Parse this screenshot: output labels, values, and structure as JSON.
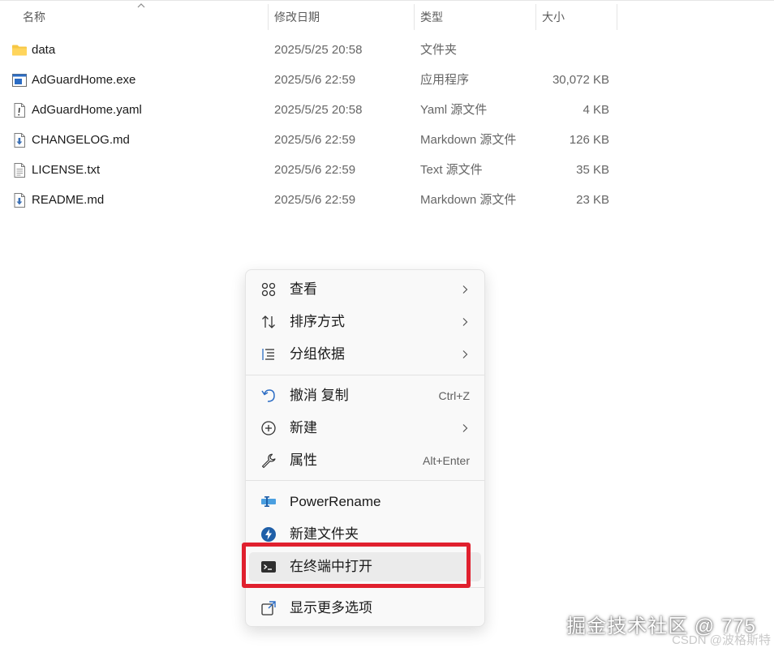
{
  "columns": {
    "name": "名称",
    "modified": "修改日期",
    "type": "类型",
    "size": "大小"
  },
  "files": [
    {
      "icon": "folder-icon",
      "name": "data",
      "modified": "2025/5/25 20:58",
      "type": "文件夹",
      "size": ""
    },
    {
      "icon": "exe-file-icon",
      "name": "AdGuardHome.exe",
      "modified": "2025/5/6 22:59",
      "type": "应用程序",
      "size": "30,072 KB"
    },
    {
      "icon": "yaml-file-icon",
      "name": "AdGuardHome.yaml",
      "modified": "2025/5/25 20:58",
      "type": "Yaml 源文件",
      "size": "4 KB"
    },
    {
      "icon": "markdown-file-icon",
      "name": "CHANGELOG.md",
      "modified": "2025/5/6 22:59",
      "type": "Markdown 源文件",
      "size": "126 KB"
    },
    {
      "icon": "text-file-icon",
      "name": "LICENSE.txt",
      "modified": "2025/5/6 22:59",
      "type": "Text 源文件",
      "size": "35 KB"
    },
    {
      "icon": "markdown-file-icon",
      "name": "README.md",
      "modified": "2025/5/6 22:59",
      "type": "Markdown 源文件",
      "size": "23 KB"
    }
  ],
  "context_menu": {
    "items": [
      {
        "icon": "grid-view-icon",
        "label": "查看",
        "submenu": true
      },
      {
        "icon": "sort-icon",
        "label": "排序方式",
        "submenu": true
      },
      {
        "icon": "group-by-icon",
        "label": "分组依据",
        "submenu": true
      },
      {
        "icon": "undo-icon",
        "label": "撤消 复制",
        "shortcut": "Ctrl+Z"
      },
      {
        "icon": "new-plus-icon",
        "label": "新建",
        "submenu": true
      },
      {
        "icon": "wrench-properties-icon",
        "label": "属性",
        "shortcut": "Alt+Enter"
      },
      {
        "icon": "powerrename-icon",
        "label": "PowerRename"
      },
      {
        "icon": "new-folder-bolt-icon",
        "label": "新建文件夹"
      },
      {
        "icon": "terminal-icon",
        "label": "在终端中打开",
        "highlighted": true
      },
      {
        "icon": "more-options-icon",
        "label": "显示更多选项"
      }
    ]
  },
  "highlight_color": "#e0202e",
  "watermark": {
    "main": "掘金技术社区 @ 775",
    "sub": "CSDN @波格斯特"
  }
}
